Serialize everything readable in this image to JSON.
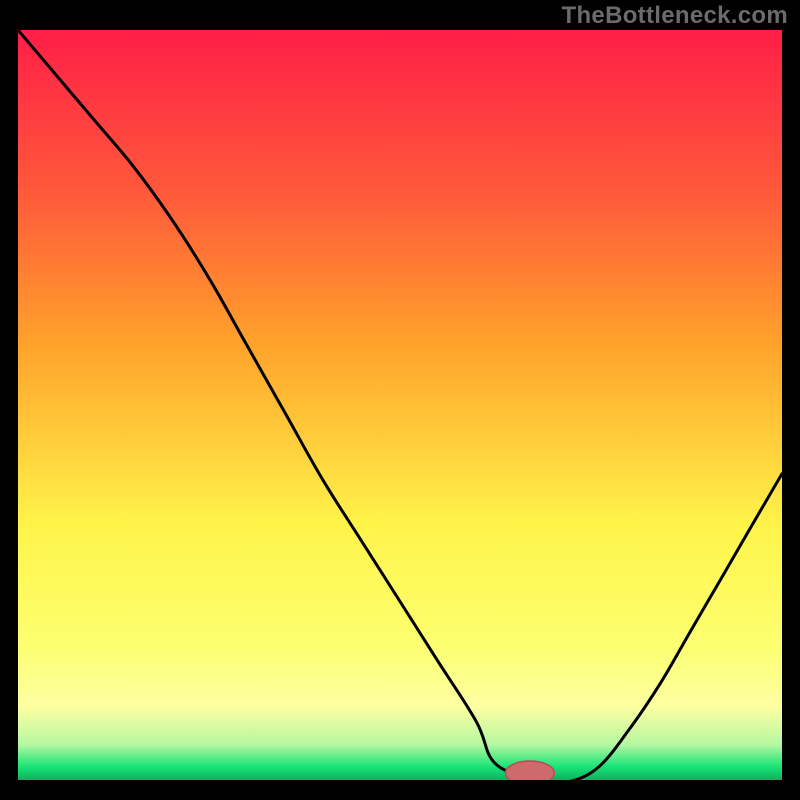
{
  "watermark": "TheBottleneck.com",
  "colors": {
    "black": "#000000",
    "topRed": "#ff1e47",
    "midOrange": "#ffa32b",
    "yellow": "#fff44a",
    "lightYellow": "#fdffa2",
    "green": "#17e477",
    "darkGreen": "#0fa858",
    "markerFill": "#cc6a6c",
    "markerStroke": "#b94e54",
    "curveStroke": "#000000"
  },
  "chart_data": {
    "type": "line",
    "title": "",
    "xlabel": "",
    "ylabel": "",
    "xlim": [
      0,
      100
    ],
    "ylim": [
      0,
      100
    ],
    "grid": false,
    "legend": false,
    "x": [
      0,
      5,
      10,
      15,
      20,
      25,
      30,
      35,
      40,
      45,
      50,
      55,
      60,
      62,
      65,
      68,
      72,
      76,
      80,
      84,
      88,
      92,
      96,
      100
    ],
    "values": [
      100,
      94,
      88,
      82,
      75,
      67,
      58,
      49,
      40,
      32,
      24,
      16,
      8,
      3,
      1,
      0,
      0,
      2,
      7,
      13,
      20,
      27,
      34,
      41
    ],
    "marker": {
      "x": 67,
      "y": 1.2,
      "rx": 3.2,
      "ry": 1.6
    }
  }
}
